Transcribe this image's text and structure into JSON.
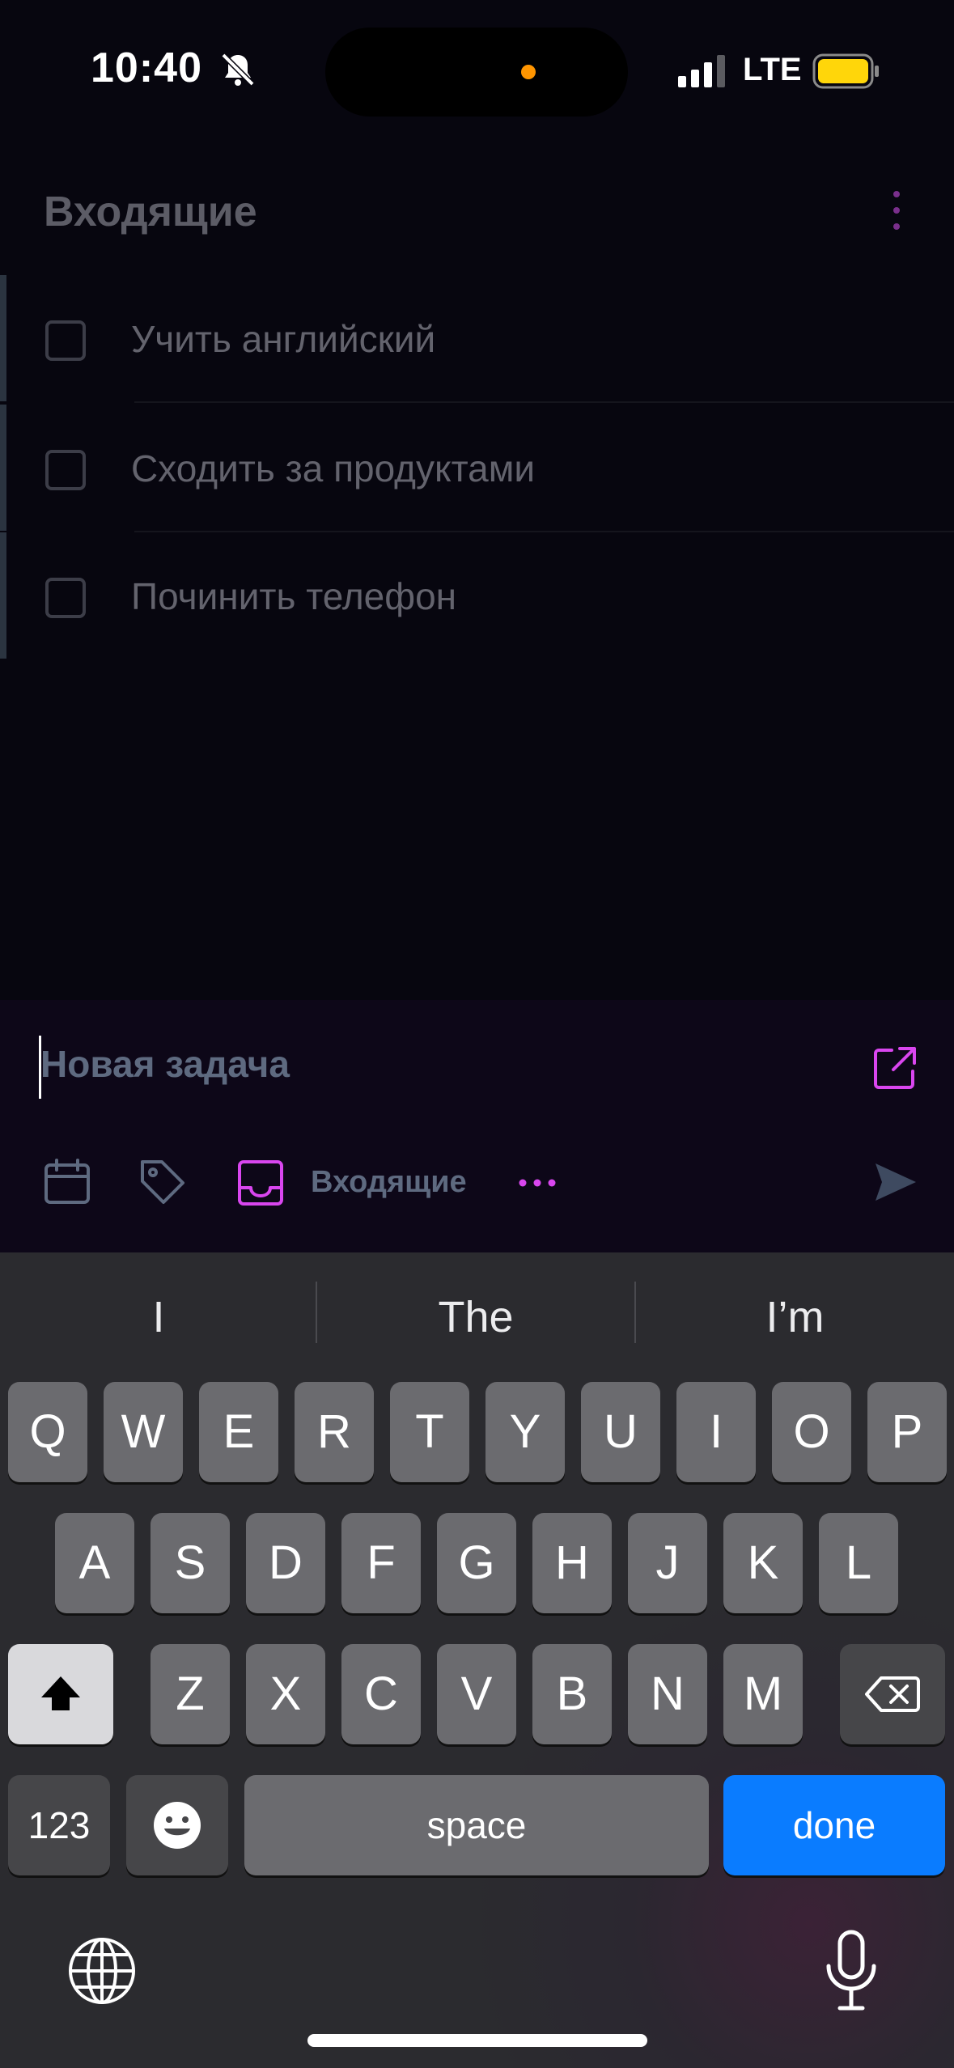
{
  "status_bar": {
    "time": "10:40",
    "network": "LTE"
  },
  "header": {
    "title": "Входящие"
  },
  "tasks": [
    {
      "label": "Учить английский",
      "done": false
    },
    {
      "label": "Сходить за продуктами",
      "done": false
    },
    {
      "label": "Починить телефон",
      "done": false
    }
  ],
  "composer": {
    "placeholder": "Новая задача",
    "project": "Входящие"
  },
  "keyboard": {
    "suggestions": [
      "I",
      "The",
      "I’m"
    ],
    "row1": [
      "Q",
      "W",
      "E",
      "R",
      "T",
      "Y",
      "U",
      "I",
      "O",
      "P"
    ],
    "row2": [
      "A",
      "S",
      "D",
      "F",
      "G",
      "H",
      "J",
      "K",
      "L"
    ],
    "row3": [
      "Z",
      "X",
      "C",
      "V",
      "B",
      "N",
      "M"
    ],
    "numbers_label": "123",
    "space_label": "space",
    "done_label": "done"
  },
  "colors": {
    "accent": "#d946ef",
    "done_key": "#0a7cff",
    "battery": "#ffd60a"
  }
}
